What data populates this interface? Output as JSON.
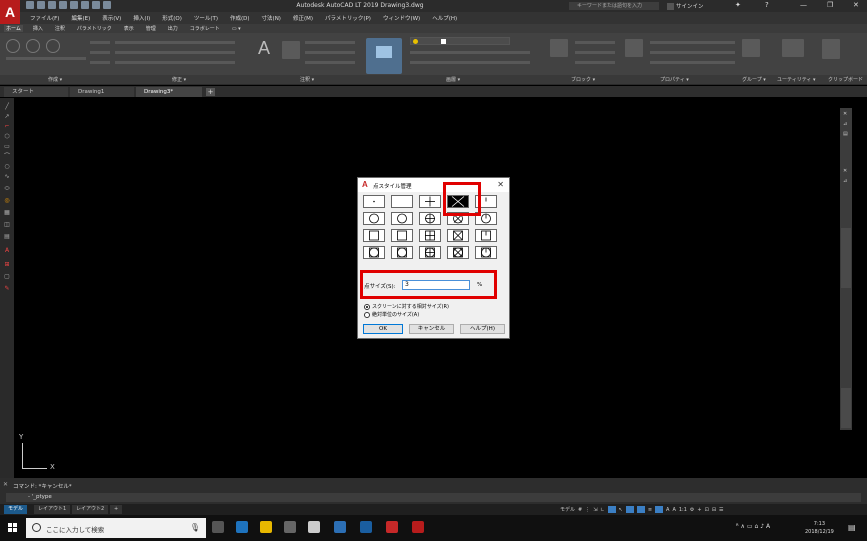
{
  "titlebar": {
    "title": "Autodesk AutoCAD LT 2019   Drawing3.dwg",
    "search_placeholder": "キーワードまたは語句を入力",
    "signin": "サインイン",
    "min": "—",
    "restore": "❐",
    "close": "✕"
  },
  "menubar": {
    "items": [
      "ファイル(F)",
      "編集(E)",
      "表示(V)",
      "挿入(I)",
      "形式(O)",
      "ツール(T)",
      "作成(D)",
      "寸法(N)",
      "修正(M)",
      "パラメトリック(P)",
      "ウィンドウ(W)",
      "ヘルプ(H)"
    ]
  },
  "ribbon_tabs": {
    "items": [
      "ホーム",
      "挿入",
      "注釈",
      "パラメトリック",
      "表示",
      "管理",
      "出力",
      "コラボレート"
    ]
  },
  "ribbon_groups": {
    "labels": [
      "作成 ▾",
      "修正 ▾",
      "注釈 ▾",
      "画層 ▾",
      "ブロック ▾",
      "プロパティ ▾",
      "グループ ▾",
      "ユーティリティ ▾",
      "クリップボード"
    ]
  },
  "doc_tabs": {
    "items": [
      "スタート",
      "Drawing1",
      "Drawing3*"
    ],
    "plus": "+"
  },
  "canvas": {
    "y_axis": "Y",
    "x_axis": "X"
  },
  "dialog": {
    "title": "点スタイル管理",
    "close": "✕",
    "size_label": "点サイズ(S):",
    "size_value": "3",
    "size_unit": "%",
    "radio_relative": "スクリーンに対する相対サイズ(R)",
    "radio_absolute": "絶対単位のサイズ(A)",
    "ok": "OK",
    "cancel": "キャンセル",
    "help": "ヘルプ(H)",
    "selected_style_index": 3
  },
  "command": {
    "history": "コマンド: *キャンセル*",
    "input": "- '_ptype"
  },
  "status": {
    "layouts": [
      "モデル",
      "レイアウト1",
      "レイアウト2"
    ],
    "plus": "+",
    "model": "モデル"
  },
  "taskbar": {
    "search": "ここに入力して検索",
    "time": "7:13",
    "date": "2018/12/19",
    "ime": "A"
  },
  "colors": {
    "highlight": "#e00000",
    "autocad_red": "#b71c1c",
    "accent": "#0078d7"
  }
}
